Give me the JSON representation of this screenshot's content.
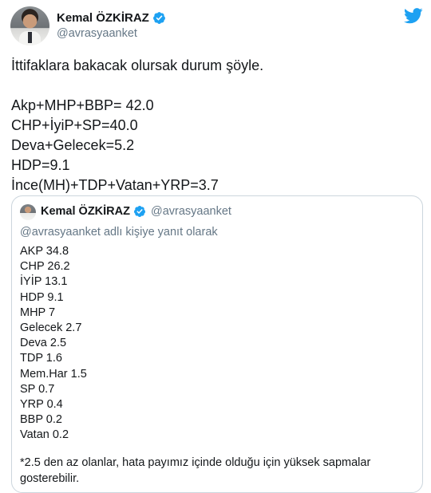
{
  "author": {
    "name": "Kemal ÖZKİRAZ",
    "handle": "@avrasyaanket"
  },
  "tweet": {
    "intro": "İttifaklara bakacak olursak durum şöyle.",
    "lines": [
      "Akp+MHP+BBP= 42.0",
      "CHP+İyiP+SP=40.0",
      "Deva+Gelecek=5.2",
      "HDP=9.1",
      "İnce(MH)+TDP+Vatan+YRP=3.7"
    ]
  },
  "quoted": {
    "name": "Kemal ÖZKİRAZ",
    "handle": "@avrasyaanket",
    "reply_context": "@avrasyaanket adlı kişiye yanıt olarak",
    "results": [
      "AKP 34.8",
      "CHP 26.2",
      "İYİP 13.1",
      "HDP 9.1",
      "MHP 7",
      "Gelecek 2.7",
      "Deva 2.5",
      "TDP 1.6",
      "Mem.Har 1.5",
      "SP 0.7",
      "YRP 0.4",
      "BBP 0.2",
      "Vatan 0.2"
    ],
    "note": "*2.5 den az olanlar, hata payımız içinde olduğu için yüksek sapmalar gosterebilir."
  },
  "colors": {
    "twitter_blue": "#1da1f2",
    "secondary_text": "#657786",
    "border": "#ccd6dd"
  },
  "icons": [
    "twitter-bird-icon",
    "verified-badge-icon"
  ]
}
